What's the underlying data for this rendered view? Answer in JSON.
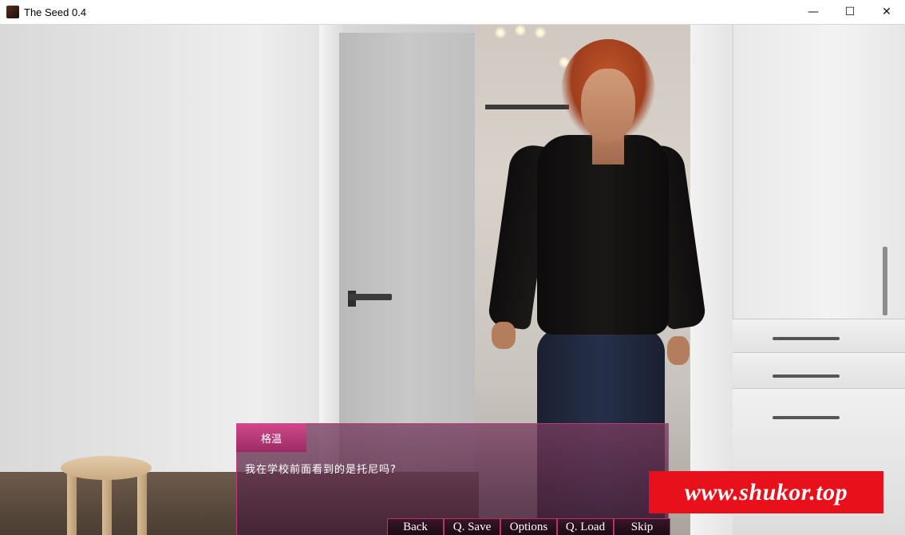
{
  "window": {
    "title": "The Seed 0.4",
    "icon": "app-portrait-icon",
    "controls": {
      "minimize": "—",
      "maximize": "☐",
      "close": "✕"
    }
  },
  "dialogue": {
    "speaker": "格温",
    "text": "我在学校前面看到的是托尼吗?"
  },
  "quick_menu": {
    "back": "Back",
    "qsave": "Q. Save",
    "options": "Options",
    "qload": "Q. Load",
    "skip": "Skip"
  },
  "watermark": {
    "text": "www.shukor.top",
    "color": "#e8101a"
  },
  "colors": {
    "dialogue_border": "#c23a7a",
    "namebox": "#d0488c"
  }
}
